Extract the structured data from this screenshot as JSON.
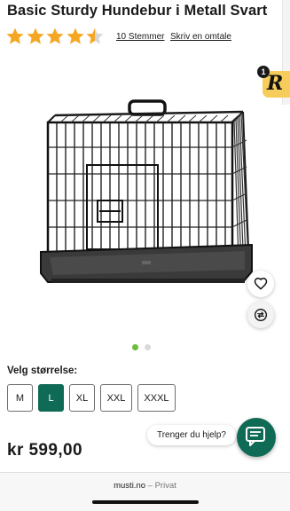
{
  "product": {
    "title": "Basic Sturdy Hundebur i Metall Svart",
    "rating": {
      "value": 4.5,
      "max": 5,
      "star_color": "#f5a623",
      "empty_star_color": "#d6d6d6",
      "votes_label": "10 Stemmer",
      "review_link": "Skriv en omtale"
    },
    "image": {
      "icon": "dog-crate-image"
    },
    "carousel": {
      "current": 1,
      "total": 2
    },
    "size_selector": {
      "label": "Velg størrelse:",
      "options": [
        "M",
        "L",
        "XL",
        "XXL",
        "XXXL"
      ],
      "selected": "L"
    },
    "price": "kr 599,00"
  },
  "actions": {
    "favorite_icon": "heart-icon",
    "compare_icon": "compare-arrows-icon"
  },
  "widget": {
    "letter": "R",
    "badge": "1",
    "color": "#f6cc5a"
  },
  "chat": {
    "bubble_text": "Trenger du hjelp?",
    "icon": "chat-icon",
    "color": "#0f6b55"
  },
  "browser": {
    "domain": "musti.no",
    "separator": "–",
    "mode": "Privat"
  },
  "colors": {
    "accent": "#0f6b55",
    "dot_active": "#6cbb3c"
  }
}
